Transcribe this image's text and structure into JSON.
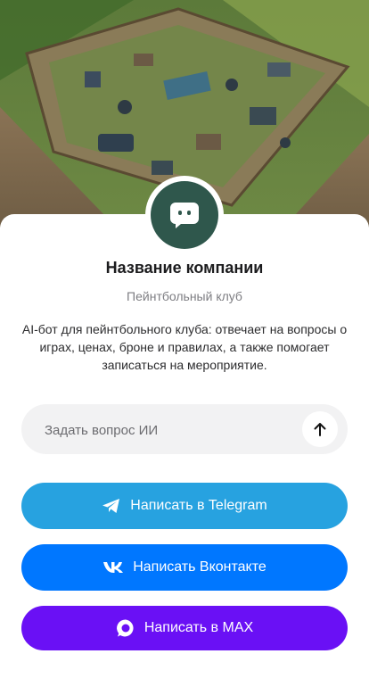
{
  "hero": {
    "image": "paintball-field-aerial-photo"
  },
  "company": {
    "avatar_icon": "chat-bubble-icon",
    "name": "Название компании",
    "category": "Пейнтбольный клуб",
    "description": "AI-бот для пейнтбольного клуба: отвечает на вопросы о играх, ценах, броне и правилах, а также помогает записаться на мероприятие."
  },
  "ask": {
    "placeholder": "Задать вопрос ИИ",
    "value": "",
    "send_icon": "arrow-up-icon"
  },
  "buttons": {
    "telegram": {
      "label": "Написать в Telegram",
      "icon": "telegram-icon",
      "color": "#27a2e0"
    },
    "vk": {
      "label": "Написать Вконтакте",
      "icon": "vk-icon",
      "color": "#0077ff"
    },
    "max": {
      "label": "Написать в MAX",
      "icon": "max-icon",
      "color": "#6a10f5"
    }
  },
  "colors": {
    "avatar_bg": "#2f574c",
    "ask_bg": "#f2f2f3"
  }
}
